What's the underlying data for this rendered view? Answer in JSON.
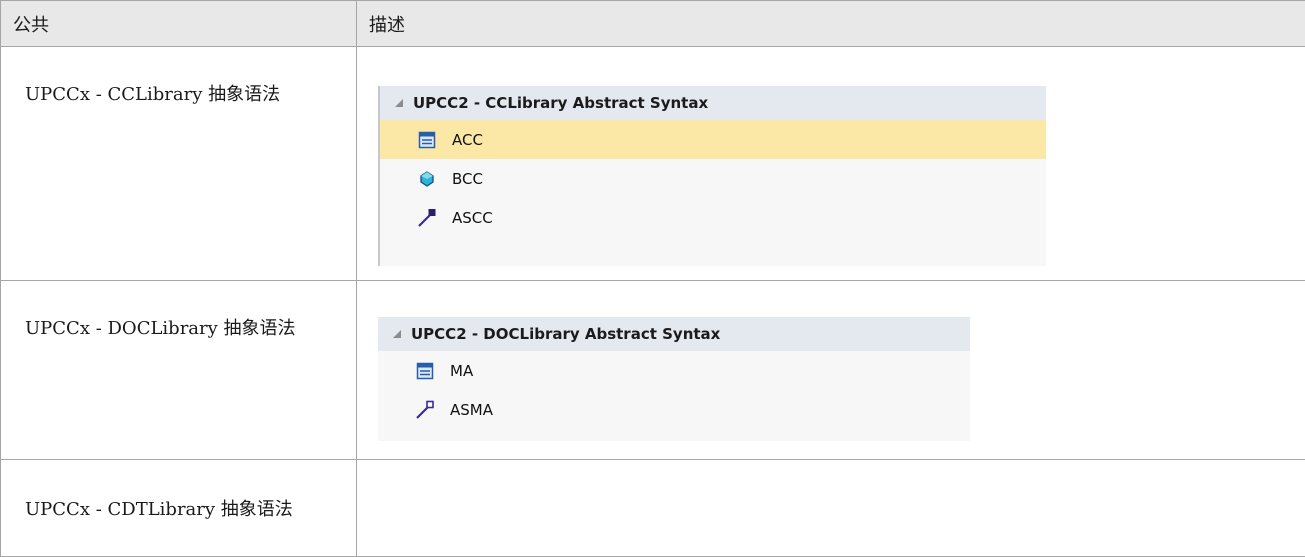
{
  "header": {
    "col1": "公共",
    "col2": "描述"
  },
  "rows": [
    {
      "name": "UPCCx - CCLibrary 抽象语法",
      "panel": {
        "title": "UPCC2 - CCLibrary Abstract Syntax",
        "items": [
          {
            "label": "ACC",
            "icon": "class-icon",
            "selected": true
          },
          {
            "label": "BCC",
            "icon": "attribute-icon",
            "selected": false
          },
          {
            "label": "ASCC",
            "icon": "association-icon",
            "selected": false
          }
        ]
      }
    },
    {
      "name": "UPCCx - DOCLibrary 抽象语法",
      "panel": {
        "title": "UPCC2 - DOCLibrary Abstract Syntax",
        "items": [
          {
            "label": "MA",
            "icon": "class-icon",
            "selected": false
          },
          {
            "label": "ASMA",
            "icon": "association-icon",
            "selected": false
          }
        ]
      }
    },
    {
      "name": "UPCCx - CDTLibrary 抽象语法"
    }
  ],
  "colors": {
    "header_bg": "#e8e8e8",
    "panel_header_bg": "#e4e8ef",
    "selected_bg": "#fbe8a6",
    "border": "#a6a6a6"
  }
}
